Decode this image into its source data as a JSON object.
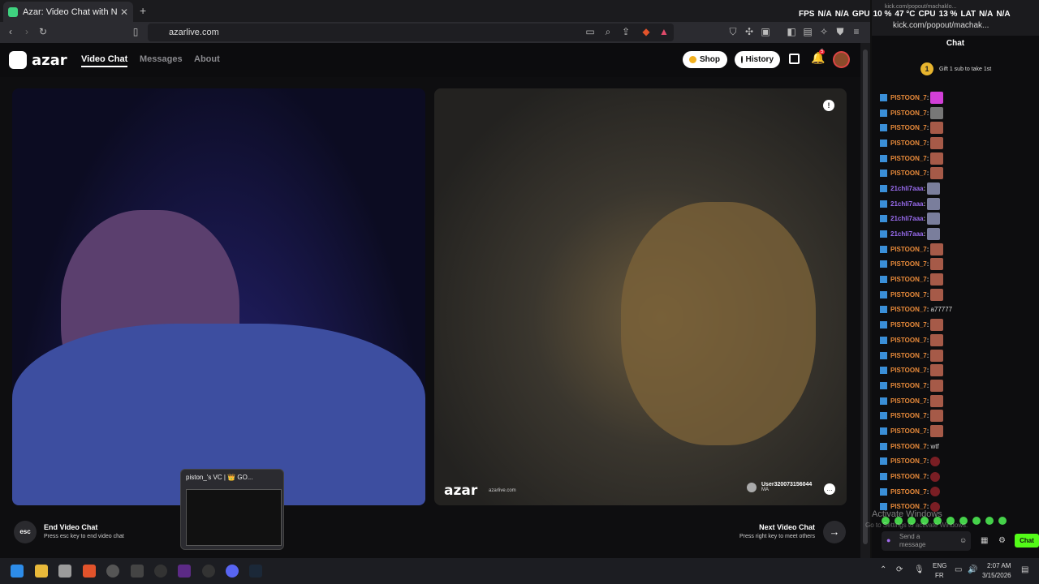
{
  "browser": {
    "tab_title": "Azar: Video Chat with New Pe",
    "url": "azarlive.com"
  },
  "site": {
    "logo_text": "azar",
    "nav": [
      "Video Chat",
      "Messages",
      "About"
    ],
    "shop_label": "Shop",
    "history_label": "History",
    "notification_count": "5"
  },
  "video": {
    "watermark": "azar",
    "watermark_sub": "azarlive.com",
    "partner_name": "User320073156044",
    "partner_country": "MA"
  },
  "footer": {
    "esc_key": "esc",
    "end_label": "End Video Chat",
    "end_hint": "Press esc key to end video chat",
    "next_label": "Next Video Chat",
    "next_hint": "Press right key to meet others"
  },
  "popup": {
    "title": "piston_'s VC | 👑 GO..."
  },
  "side": {
    "url_small": "kick.com/popout/machaklo...",
    "url": "kick.com/popout/machak...",
    "chat_title": "Chat",
    "gift_count": "1",
    "gift_text": "Gift 1 sub to take 1st",
    "send_placeholder": "Send a message",
    "chat_button": "Chat"
  },
  "chat_messages": [
    {
      "user": "PISTOON_7",
      "text": "",
      "emote": "pink"
    },
    {
      "user": "PISTOON_7",
      "text": "",
      "emote": "gray"
    },
    {
      "user": "PISTOON_7",
      "text": "",
      "emote": "face"
    },
    {
      "user": "PISTOON_7",
      "text": "",
      "emote": "face"
    },
    {
      "user": "PISTOON_7",
      "text": "",
      "emote": "face"
    },
    {
      "user": "PISTOON_7",
      "text": "",
      "emote": "face"
    },
    {
      "user": "21chli7aaa",
      "text": "",
      "emote": "person"
    },
    {
      "user": "21chli7aaa",
      "text": "",
      "emote": "person"
    },
    {
      "user": "21chli7aaa",
      "text": "",
      "emote": "person"
    },
    {
      "user": "21chli7aaa",
      "text": "",
      "emote": "person"
    },
    {
      "user": "PISTOON_7",
      "text": "",
      "emote": "face"
    },
    {
      "user": "PISTOON_7",
      "text": "",
      "emote": "face"
    },
    {
      "user": "PISTOON_7",
      "text": "",
      "emote": "face"
    },
    {
      "user": "PISTOON_7",
      "text": "",
      "emote": "face"
    },
    {
      "user": "PISTOON_7",
      "text": "a77777",
      "emote": ""
    },
    {
      "user": "PISTOON_7",
      "text": "",
      "emote": "face"
    },
    {
      "user": "PISTOON_7",
      "text": "",
      "emote": "face"
    },
    {
      "user": "PISTOON_7",
      "text": "",
      "emote": "face"
    },
    {
      "user": "PISTOON_7",
      "text": "",
      "emote": "face"
    },
    {
      "user": "PISTOON_7",
      "text": "",
      "emote": "face"
    },
    {
      "user": "PISTOON_7",
      "text": "",
      "emote": "face"
    },
    {
      "user": "PISTOON_7",
      "text": "",
      "emote": "face"
    },
    {
      "user": "PISTOON_7",
      "text": "",
      "emote": "face"
    },
    {
      "user": "PISTOON_7",
      "text": "wtf",
      "emote": ""
    },
    {
      "user": "PISTOON_7",
      "text": "",
      "emote": "red"
    },
    {
      "user": "PISTOON_7",
      "text": "",
      "emote": "red"
    },
    {
      "user": "PISTOON_7",
      "text": "",
      "emote": "red"
    },
    {
      "user": "PISTOON_7",
      "text": "",
      "emote": "red"
    }
  ],
  "overlay": {
    "activate_title": "Activate Windows",
    "activate_sub": "Go to Settings to activate Windows.",
    "stats": [
      "FPS",
      "N/A",
      "N/A",
      "GPU",
      "10 %",
      "47 °C",
      "CPU",
      "13 %",
      "LAT",
      "N/A",
      "N/A"
    ]
  },
  "taskbar": {
    "lang_top": "ENG",
    "lang_bottom": "FR",
    "time": "2:07 AM",
    "date": "3/15/2026"
  },
  "colors": {
    "kick_green": "#53fc18",
    "username_orange": "#e88a3a",
    "username_purple": "#9a6cf0"
  }
}
